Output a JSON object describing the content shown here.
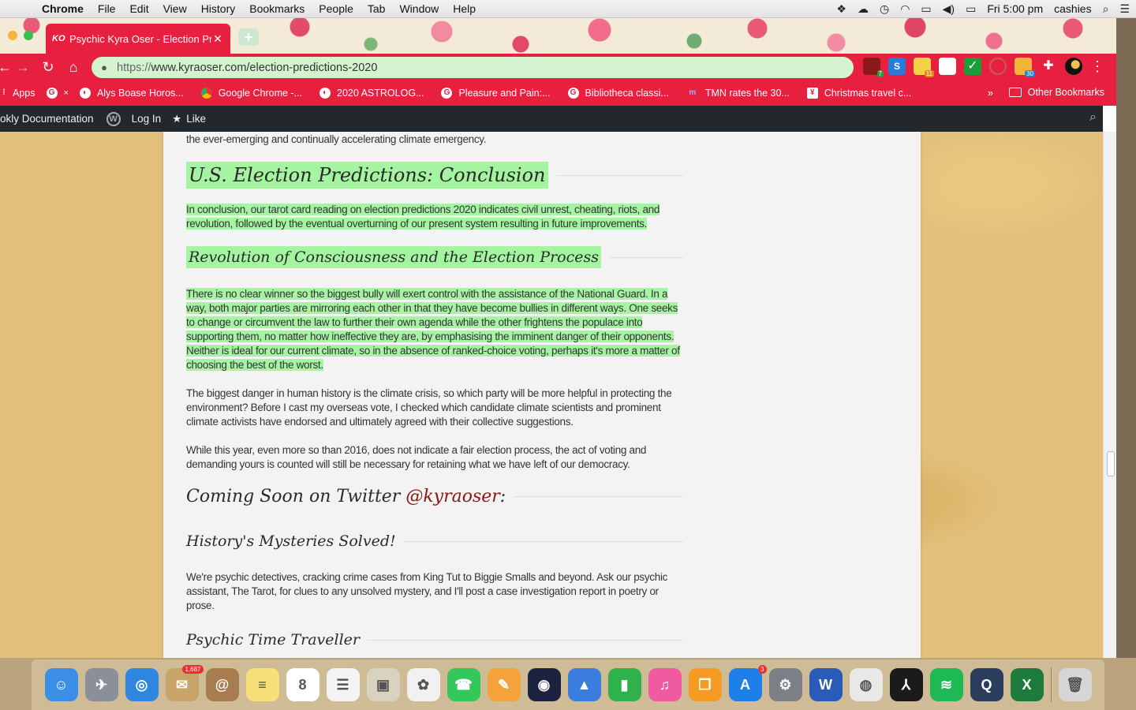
{
  "menubar": {
    "app": "Chrome",
    "items": [
      "File",
      "Edit",
      "View",
      "History",
      "Bookmarks",
      "People",
      "Tab",
      "Window",
      "Help"
    ],
    "clock": "Fri 5:00 pm",
    "user": "cashies"
  },
  "tab": {
    "favicon": "KO",
    "title": "Psychic Kyra Oser - Election Pr"
  },
  "omnibox": {
    "protocol": "https://",
    "host_path": "www.kyraoser.com/election-predictions-2020"
  },
  "extensions": [
    {
      "name": "ext-red-icon",
      "color": "#8b1a1a",
      "badge": "7"
    },
    {
      "name": "ext-s-icon",
      "color": "#2b79d8",
      "badge": ""
    },
    {
      "name": "ext-scissors-icon",
      "color": "#f2d34a",
      "badge": "11"
    },
    {
      "name": "ext-square-icon",
      "color": "#ffffff",
      "badge": ""
    },
    {
      "name": "ext-check-icon",
      "color": "#1a9e3a",
      "badge": ""
    },
    {
      "name": "ext-circle-icon",
      "color": "#c95b5b",
      "badge": ""
    },
    {
      "name": "ext-notes-icon",
      "color": "#f4b53a",
      "badge": "30"
    }
  ],
  "bookmarks": {
    "apps_label": "Apps",
    "items": [
      {
        "label": "Alys Boase Horos...",
        "icon": "alys-icon"
      },
      {
        "label": "Google Chrome -...",
        "icon": "chrome-icon"
      },
      {
        "label": "2020 ASTROLOG...",
        "icon": "astrolog-icon"
      },
      {
        "label": "Pleasure and Pain:...",
        "icon": "google-icon"
      },
      {
        "label": "Bibliotheca classi...",
        "icon": "google-icon"
      },
      {
        "label": "TMN rates the 30...",
        "icon": "tmn-icon"
      },
      {
        "label": "Christmas travel c...",
        "icon": "christmas-icon"
      }
    ],
    "more": "»",
    "other": "Other Bookmarks"
  },
  "wpbar": {
    "docs": "okly Documentation",
    "login": "Log In",
    "like": "Like"
  },
  "article": {
    "intro_tail": "the ever-emerging and continually accelerating climate emergency.",
    "h_conclusion": "U.S. Election Predictions: Conclusion",
    "p_conclusion": "In conclusion, our tarot card reading on election predictions 2020 indicates civil unrest, cheating, riots, and revolution, followed by the eventual overturning of our present system resulting in future improvements.",
    "h_revolution": "Revolution of Consciousness and the Election Process",
    "p_revolution": "There is no clear winner so the biggest bully will exert control with the assistance of the National Guard. In a way, both major parties are mirroring each other in that they have become bullies in different ways. One seeks to change or circumvent the law to further their own agenda while the other frightens the populace into supporting them, no matter how ineffective they are, by emphasising the imminent danger of their opponents. Neither is ideal for our current climate, so in the absence of ranked-choice voting, perhaps it's more a matter of choosing the best of the worst.",
    "p_danger": "The biggest danger in human history is the climate crisis, so which party will be more helpful in protecting the environment? Before I cast my overseas vote, I checked which candidate climate scientists and prominent climate activists have endorsed and ultimately agreed with their collective suggestions.",
    "p_while": "While this year, even more so than 2016, does not indicate a fair election process, the act of voting and demanding yours is counted will still be necessary for retaining what we have left of our democracy.",
    "h_coming": "Coming Soon on Twitter",
    "twitter_handle": "@kyraoser",
    "h_coming_colon": " :",
    "h_history": "History's Mysteries Solved!",
    "p_history": "We're psychic detectives, cracking crime cases from King Tut to Biggie Smalls and beyond. Ask our psychic assistant, The Tarot, for clues to any unsolved mystery, and I'll post a case investigation report in poetry or prose.",
    "h_time": "Psychic Time Traveller"
  },
  "dock": [
    {
      "name": "finder-icon",
      "color": "#3a8ee6",
      "glyph": "☺",
      "badge": ""
    },
    {
      "name": "launchpad-icon",
      "color": "#8a8f99",
      "glyph": "✈",
      "badge": ""
    },
    {
      "name": "safari-icon",
      "color": "#2f86de",
      "glyph": "◎",
      "badge": ""
    },
    {
      "name": "mail-stamp-icon",
      "color": "#c9a46a",
      "glyph": "✉",
      "badge": "1,687"
    },
    {
      "name": "contacts-icon",
      "color": "#a77d4f",
      "glyph": "@",
      "badge": ""
    },
    {
      "name": "notes-icon",
      "color": "#f7e07a",
      "glyph": "≡",
      "badge": ""
    },
    {
      "name": "calendar-icon",
      "color": "#ffffff",
      "glyph": "8",
      "badge": ""
    },
    {
      "name": "reminders-icon",
      "color": "#f4f4f4",
      "glyph": "☰",
      "badge": ""
    },
    {
      "name": "preview-icon",
      "color": "#d9d2c0",
      "glyph": "▣",
      "badge": ""
    },
    {
      "name": "photos-icon",
      "color": "#f1f1f1",
      "glyph": "✿",
      "badge": ""
    },
    {
      "name": "facetime-icon",
      "color": "#34c759",
      "glyph": "☎",
      "badge": ""
    },
    {
      "name": "pages-icon",
      "color": "#f4a23a",
      "glyph": "✎",
      "badge": ""
    },
    {
      "name": "siri-icon",
      "color": "#1c2240",
      "glyph": "◉",
      "badge": ""
    },
    {
      "name": "keynote-icon",
      "color": "#3b7ddd",
      "glyph": "▲",
      "badge": ""
    },
    {
      "name": "numbers-icon",
      "color": "#2fb24c",
      "glyph": "▮",
      "badge": ""
    },
    {
      "name": "itunes-icon",
      "color": "#f05aa0",
      "glyph": "♫",
      "badge": ""
    },
    {
      "name": "ibooks-icon",
      "color": "#f59a23",
      "glyph": "❐",
      "badge": ""
    },
    {
      "name": "app-store-icon",
      "color": "#1e7fe8",
      "glyph": "A",
      "badge": "3"
    },
    {
      "name": "system-preferences-icon",
      "color": "#7b7f86",
      "glyph": "⚙",
      "badge": ""
    },
    {
      "name": "word-icon",
      "color": "#2b5bb8",
      "glyph": "W",
      "badge": ""
    },
    {
      "name": "chrome-icon",
      "color": "#e8e8e8",
      "glyph": "◍",
      "badge": ""
    },
    {
      "name": "acrobat-icon",
      "color": "#1b1b1b",
      "glyph": "⅄",
      "badge": ""
    },
    {
      "name": "spotify-icon",
      "color": "#1db954",
      "glyph": "≋",
      "badge": ""
    },
    {
      "name": "quicktime-icon",
      "color": "#2a3d5c",
      "glyph": "Q",
      "badge": ""
    },
    {
      "name": "excel-icon",
      "color": "#1f7a3e",
      "glyph": "X",
      "badge": ""
    },
    {
      "name": "trash-icon",
      "color": "#d6d6d6",
      "glyph": "🗑",
      "badge": ""
    }
  ]
}
